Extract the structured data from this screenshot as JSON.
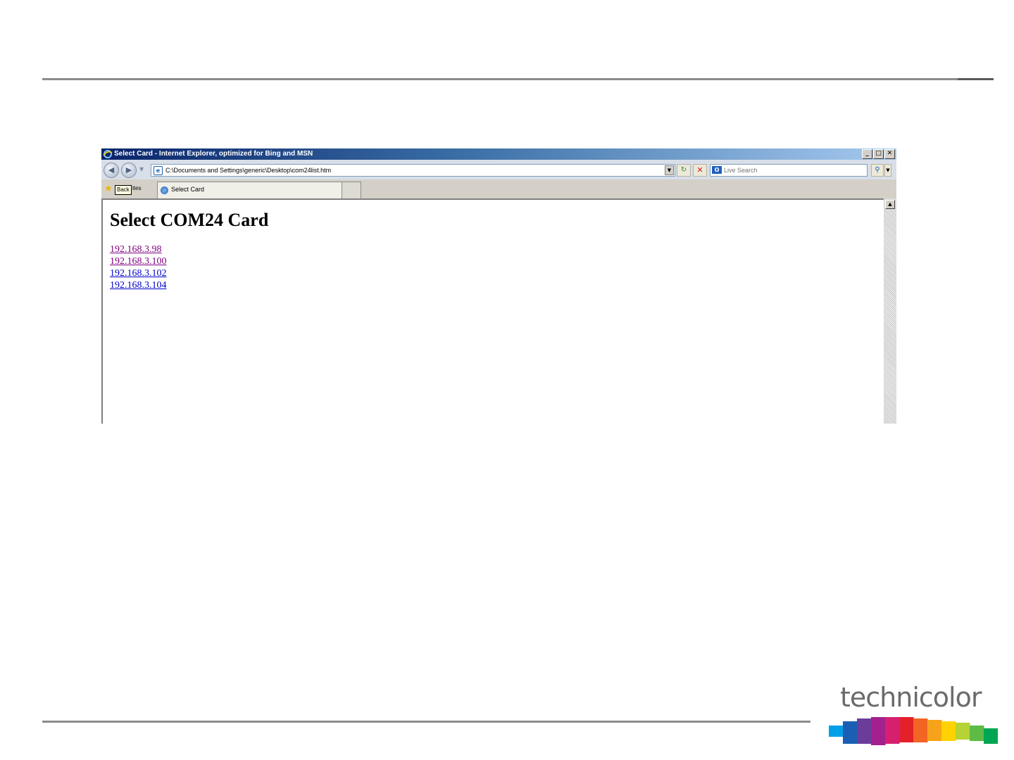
{
  "browser": {
    "window_title": "Select Card - Internet Explorer, optimized for Bing and MSN",
    "window_controls": {
      "minimize": "_",
      "restore": "□",
      "close": "✕"
    },
    "address_url": "C:\\Documents and Settings\\generic\\Desktop\\com24list.htm",
    "search_placeholder": "Live Search",
    "favorites_label": "ites",
    "tooltip": "Back",
    "tab_title": "Select Card"
  },
  "page": {
    "heading": "Select COM24 Card",
    "links": [
      {
        "text": "192.168.3.98",
        "state": "visited"
      },
      {
        "text": "192.168.3.100",
        "state": "visited"
      },
      {
        "text": "192.168.3.102",
        "state": "unvisited"
      },
      {
        "text": "192.168.3.104",
        "state": "unvisited"
      }
    ]
  },
  "brand": {
    "logo_text": "technicolor",
    "colors": [
      "#00a0e9",
      "#1a5fb4",
      "#6a3d9a",
      "#a3208f",
      "#d6206f",
      "#e4202a",
      "#f26522",
      "#f7a21b",
      "#ffd200",
      "#b5d334",
      "#5dbb46",
      "#00a651"
    ]
  },
  "icons": [
    "ie-logo-icon",
    "back-arrow-icon",
    "forward-arrow-icon",
    "refresh-icon",
    "stop-icon",
    "search-icon",
    "favorites-star-icon",
    "scroll-up-arrow-icon"
  ]
}
